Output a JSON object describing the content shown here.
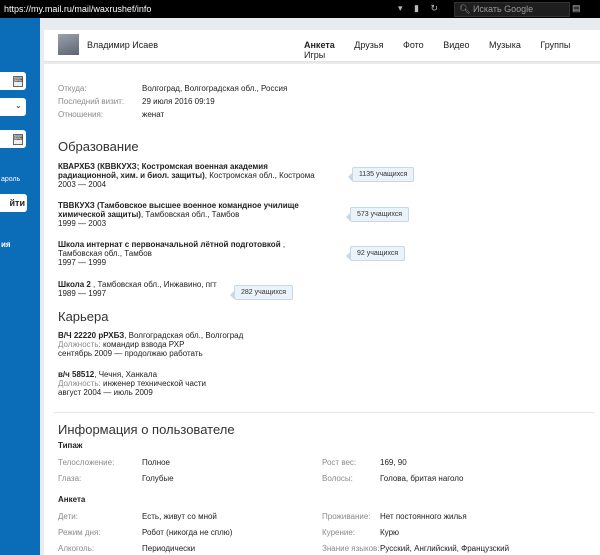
{
  "browser": {
    "url": "https://my.mail.ru/mail/waxrushef/info",
    "search_placeholder": "Искать Google"
  },
  "sidebar": {
    "link": "ароль",
    "button": "йти",
    "label": "ия"
  },
  "header": {
    "user_name": "Владимир Исаев",
    "nav": [
      "Анкета",
      "Друзья",
      "Фото",
      "Видео",
      "Музыка",
      "Группы",
      "Игры"
    ]
  },
  "basic": [
    {
      "label": "Откуда:",
      "value": "Волгоград, Волгоградская обл., Россия"
    },
    {
      "label": "Последний визит:",
      "value": "29 июля 2016 09:19"
    },
    {
      "label": "Отношения:",
      "value": "женат"
    }
  ],
  "education": {
    "title": "Образование",
    "schools": [
      {
        "name1": "КВАРХБЗ (КВВКУХЗ; Костромская военная академия",
        "name2": "радиационной, хим. и биол. защиты)",
        "loc": ", Костромская обл., Кострома",
        "years": "2003 — 2004",
        "badge": "1135 учащихся"
      },
      {
        "name1": "ТВВКУХЗ (Тамбовское высшее военное командное училище",
        "name2": "химической защиты)",
        "loc": ", Тамбовская обл., Тамбов",
        "years": "1999 — 2003",
        "badge": "573 учащихся"
      },
      {
        "name1": "Школа интернат с первоначальной лётной подготовкой",
        "name1_suffix": " ,",
        "name2": "",
        "loc": "Тамбовская обл., Тамбов",
        "years": "1997 — 1999",
        "badge": "92 учащихся"
      },
      {
        "name1": "Школа 2",
        "name1_suffix": " , Тамбовская обл., Инжавино, пгт",
        "years": "1989 — 1997",
        "badge": "282 учащихся"
      }
    ]
  },
  "career": {
    "title": "Карьера",
    "jobs": [
      {
        "name": "В/Ч 22220 рРХБЗ",
        "loc": ", Волгоградская обл., Волгоград",
        "pos_label": "Должность:",
        "pos": "командир взвода РХР",
        "period": "сентябрь 2009 — продолжаю работать"
      },
      {
        "name": "в/ч 58512",
        "loc": ", Чечня, Ханкала",
        "pos_label": "Должность:",
        "pos": "инженер технической части",
        "period": "август 2004 — июль 2009"
      }
    ]
  },
  "user_info": {
    "title": "Информация о пользователе",
    "type_title": "Типаж",
    "type_rows": [
      {
        "l1": "Телосложение:",
        "v1": "Полное",
        "l2": "Рост вес:",
        "v2": "169, 90"
      },
      {
        "l1": "Глаза:",
        "v1": "Голубые",
        "l2": "Волосы:",
        "v2": "Голова, бритая наголо"
      }
    ],
    "form_title": "Анкета",
    "form_rows": [
      {
        "l1": "Дети:",
        "v1": "Есть, живут со мной",
        "l2": "Проживание:",
        "v2": "Нет постоянного жилья"
      },
      {
        "l1": "Режим дня:",
        "v1": "Робот (никогда не сплю)",
        "l2": "Курение:",
        "v2": "Курю"
      },
      {
        "l1": "Алкоголь:",
        "v1": "Периодически",
        "l2": "Знание языков:",
        "v2": "Русский, Английский, Французский"
      }
    ]
  }
}
